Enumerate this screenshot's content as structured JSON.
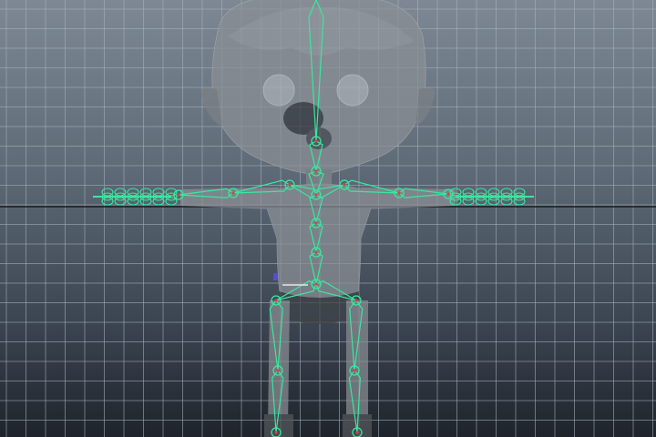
{
  "viewport": {
    "view": "front",
    "background_top_color": "#7d8894",
    "background_bottom_color": "#1f242b",
    "grid_color": "#aab3bd",
    "grid_axis_color": "#1a1a1a",
    "mesh_color": "#8a8e94",
    "joint_color": "#38e8a0",
    "axis_gizmo_color": "#5a4ad8"
  },
  "icons": {
    "character_mesh": "cartoon-boy-mesh-icon",
    "skeleton": "joint-skeleton-icon",
    "pivot": "pivot-gizmo-icon"
  }
}
